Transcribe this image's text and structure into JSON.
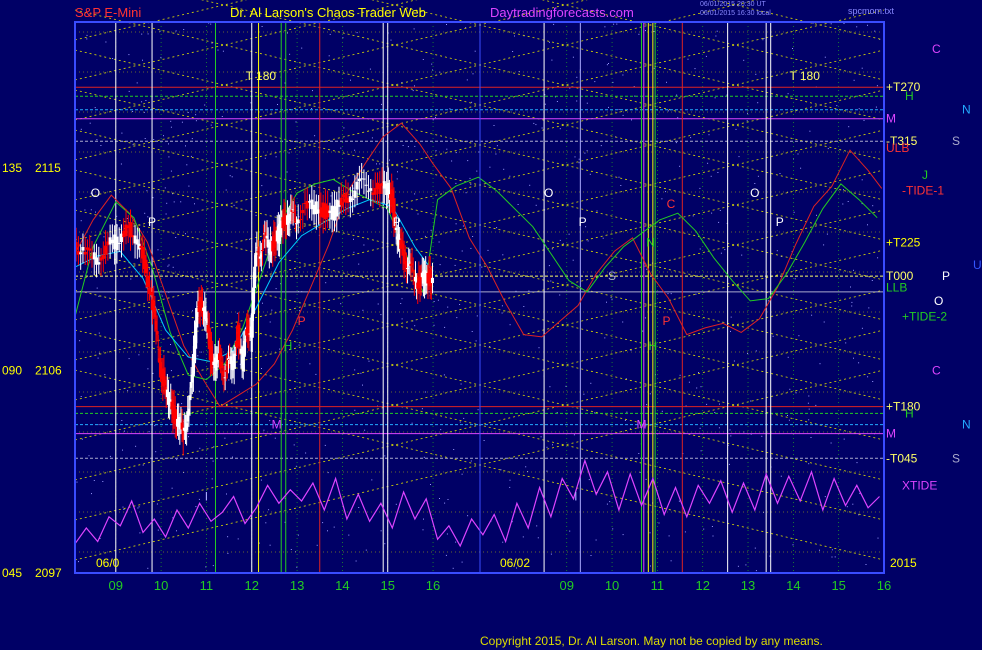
{
  "header": {
    "symbol": "S&P E-Mini",
    "site": "Dr. Al Larson's Chaos Trader Web",
    "url": "Daytradingforecasts.com",
    "stamp1": "06/01/2015 20:30 UT",
    "stamp2": "06/01/2015 16:30 local",
    "file": "spcmom.txt"
  },
  "copyright": "Copyright 2015, Dr. Al Larson. May not be copied by any means.",
  "colors": {
    "background": "#000066",
    "frame": "#3a4cff",
    "candle_up": "#ffffff",
    "candle_down": "#ff0000",
    "xtide": "#dd44ff",
    "moving_avg": "#00ccff",
    "green_band": "#22cc22",
    "red_band": "#dd2222",
    "grid_dots": "#e0e000"
  },
  "chart_data": {
    "type": "candlestick",
    "title": "S&P E-Mini",
    "y_axis_left": [
      {
        "angle": "135",
        "price": "2115"
      },
      {
        "angle": "090",
        "price": "2106"
      },
      {
        "angle": "045",
        "price": "2097"
      }
    ],
    "ylim": [
      2097,
      2121.5
    ],
    "x_ticks_day1": [
      "09",
      "10",
      "11",
      "12",
      "13",
      "14",
      "15",
      "16"
    ],
    "x_ticks_day2": [
      "09",
      "10",
      "11",
      "12",
      "13",
      "14",
      "15",
      "16"
    ],
    "date_labels": [
      "06/0",
      "06/02"
    ],
    "year_label": "2015",
    "right_labels": [
      {
        "text": "C",
        "color": "#dd44ff",
        "price": 2120.3
      },
      {
        "text": "+T270",
        "color": "#ffff66",
        "price": 2118.6
      },
      {
        "text": "H",
        "color": "#22cc22",
        "price": 2118.2
      },
      {
        "text": "N",
        "color": "#22aaff",
        "price": 2117.6
      },
      {
        "text": "M",
        "color": "#dd44ff",
        "price": 2117.2
      },
      {
        "text": "-T315",
        "color": "#ffff66",
        "price": 2116.2
      },
      {
        "text": "S",
        "color": "#aaaacc",
        "price": 2116.2
      },
      {
        "text": "ULB",
        "color": "#ff3333",
        "price": 2115.9
      },
      {
        "text": "J",
        "color": "#22cc22",
        "price": 2114.7
      },
      {
        "text": "-TIDE-1",
        "color": "#ff3333",
        "price": 2114.0
      },
      {
        "text": "+T225",
        "color": "#ffff00",
        "price": 2111.7
      },
      {
        "text": "U",
        "color": "#3355ff",
        "price": 2110.7
      },
      {
        "text": "T000",
        "color": "#ffff66",
        "price": 2110.2
      },
      {
        "text": "P",
        "color": "#ffffff",
        "price": 2110.2
      },
      {
        "text": "LLB",
        "color": "#22cc22",
        "price": 2109.7
      },
      {
        "text": "O",
        "color": "#ffffff",
        "price": 2109.1
      },
      {
        "text": "+TIDE-2",
        "color": "#22cc22",
        "price": 2108.4
      },
      {
        "text": "C",
        "color": "#dd44ff",
        "price": 2106.0
      },
      {
        "text": "+T180",
        "color": "#ffff66",
        "price": 2104.4
      },
      {
        "text": "H",
        "color": "#22cc22",
        "price": 2104.1
      },
      {
        "text": "N",
        "color": "#22aaff",
        "price": 2103.6
      },
      {
        "text": "M",
        "color": "#dd44ff",
        "price": 2103.2
      },
      {
        "text": "-T045",
        "color": "#ffff66",
        "price": 2102.1
      },
      {
        "text": "S",
        "color": "#aaaacc",
        "price": 2102.1
      },
      {
        "text": "XTIDE",
        "color": "#dd44ff",
        "price": 2100.9
      }
    ],
    "in_chart_labels": [
      {
        "text": "T 180",
        "color": "#ffff66",
        "price": 2119.1,
        "time": 12.2
      },
      {
        "text": "T 180",
        "color": "#ffff66",
        "price": 2119.1,
        "time": 24.2
      },
      {
        "text": "O",
        "color": "#ffffff",
        "price": 2113.9,
        "time": 8.55
      },
      {
        "text": "O",
        "color": "#ffffff",
        "price": 2113.9,
        "time": 18.55
      },
      {
        "text": "O",
        "color": "#ffffff",
        "price": 2113.9,
        "time": 23.1
      },
      {
        "text": "P",
        "color": "#ffffff",
        "price": 2112.6,
        "time": 9.8
      },
      {
        "text": "P",
        "color": "#ffffff",
        "price": 2112.6,
        "time": 15.2
      },
      {
        "text": "P",
        "color": "#ffffff",
        "price": 2112.6,
        "time": 19.3
      },
      {
        "text": "P",
        "color": "#ffffff",
        "price": 2112.6,
        "time": 23.65
      },
      {
        "text": "C",
        "color": "#ff3333",
        "price": 2113.4,
        "time": 21.25
      },
      {
        "text": "N",
        "color": "#22cc22",
        "price": 2111.7,
        "time": 20.8
      },
      {
        "text": "S",
        "color": "#aaaacc",
        "price": 2110.2,
        "time": 19.95
      },
      {
        "text": "P",
        "color": "#ff3333",
        "price": 2108.2,
        "time": 13.1
      },
      {
        "text": "P",
        "color": "#ff3333",
        "price": 2108.2,
        "time": 21.15
      },
      {
        "text": "H",
        "color": "#22cc22",
        "price": 2107.1,
        "time": 12.8
      },
      {
        "text": "H",
        "color": "#22cc22",
        "price": 2107.1,
        "time": 20.85
      },
      {
        "text": "M",
        "color": "#dd44ff",
        "price": 2103.6,
        "time": 12.55
      },
      {
        "text": "M",
        "color": "#dd44ff",
        "price": 2103.6,
        "time": 20.6
      },
      {
        "text": "I",
        "color": "#aaaaff",
        "price": 2100.4,
        "time": 11.0
      },
      {
        "text": "I",
        "color": "#aaaaff",
        "price": 2100.4,
        "time": 19.15
      }
    ],
    "xlim": [
      8.1,
      25.95
    ],
    "session_break": 16.0,
    "day2_offset": 9.95,
    "price_series": {
      "time": [
        8.1,
        8.3,
        8.5,
        8.7,
        8.9,
        9.1,
        9.3,
        9.5,
        9.65,
        9.8,
        9.9,
        10.0,
        10.1,
        10.2,
        10.3,
        10.4,
        10.5,
        10.6,
        10.7,
        10.8,
        10.9,
        11.0,
        11.1,
        11.2,
        11.3,
        11.4,
        11.5,
        11.6,
        11.7,
        11.8,
        11.9,
        12.0,
        12.1,
        12.2,
        12.3,
        12.4,
        12.5,
        12.6,
        12.7,
        12.8,
        12.9,
        13.0,
        13.2,
        13.4,
        13.6,
        13.8,
        14.0,
        14.2,
        14.4,
        14.6,
        14.8,
        15.0,
        15.1,
        15.2,
        15.3,
        15.4,
        15.5,
        15.6,
        15.7,
        15.8,
        15.9,
        16.0
      ],
      "price": [
        2111.7,
        2111.3,
        2110.9,
        2111.2,
        2111.6,
        2111.8,
        2112.5,
        2111.5,
        2110.8,
        2109.3,
        2107.6,
        2106.2,
        2105.1,
        2104.6,
        2104.1,
        2103.6,
        2103.1,
        2104.3,
        2105.5,
        2109.1,
        2108.8,
        2108.4,
        2106.8,
        2106.3,
        2106.5,
        2106.0,
        2106.2,
        2106.4,
        2107.7,
        2106.3,
        2107.9,
        2107.8,
        2111.1,
        2111.4,
        2111.8,
        2111.5,
        2111.7,
        2112.1,
        2112.6,
        2112.9,
        2112.8,
        2112.9,
        2113.2,
        2113.3,
        2113.1,
        2113.0,
        2113.5,
        2113.9,
        2114.2,
        2114.3,
        2114.0,
        2114.1,
        2113.7,
        2112.1,
        2111.4,
        2111.0,
        2110.5,
        2110.2,
        2109.9,
        2110.1,
        2110.2,
        2110.0
      ]
    },
    "xtide_series": {
      "time": [
        8.1,
        8.35,
        8.6,
        8.85,
        9.1,
        9.35,
        9.6,
        9.85,
        10.1,
        10.35,
        10.6,
        10.85,
        11.1,
        11.35,
        11.6,
        11.85,
        12.1,
        12.35,
        12.6,
        12.85,
        13.1,
        13.35,
        13.6,
        13.85,
        14.1,
        14.35,
        14.6,
        14.85,
        15.1,
        15.35,
        15.6,
        15.85,
        16.1,
        16.35,
        16.6,
        16.85,
        17.1,
        17.35,
        17.6,
        17.85,
        18.1,
        18.35,
        18.6,
        18.85,
        19.1,
        19.35,
        19.6,
        19.85,
        20.1,
        20.35,
        20.6,
        20.85,
        21.1,
        21.35,
        21.6,
        21.85,
        22.1,
        22.35,
        22.6,
        22.85,
        23.1,
        23.35,
        23.6,
        23.85,
        24.1,
        24.35,
        24.6,
        24.85,
        25.1,
        25.35,
        25.6,
        25.85
      ],
      "price": [
        2098.3,
        2099.0,
        2098.4,
        2099.5,
        2099.1,
        2100.2,
        2098.8,
        2099.4,
        2098.6,
        2099.8,
        2099.0,
        2100.1,
        2099.3,
        2099.7,
        2100.4,
        2099.2,
        2099.9,
        2100.9,
        2100.1,
        2100.7,
        2100.2,
        2101.0,
        2099.8,
        2101.2,
        2099.4,
        2100.5,
        2099.3,
        2100.1,
        2099.0,
        2100.6,
        2099.4,
        2100.3,
        2098.5,
        2099.1,
        2098.2,
        2099.4,
        2098.7,
        2099.6,
        2098.4,
        2100.1,
        2099.0,
        2100.8,
        2099.5,
        2101.2,
        2100.3,
        2102.0,
        2100.5,
        2101.5,
        2099.8,
        2101.4,
        2100.0,
        2101.2,
        2099.6,
        2100.8,
        2099.5,
        2100.9,
        2100.1,
        2101.1,
        2099.7,
        2101.0,
        2099.8,
        2101.4,
        2100.1,
        2101.3,
        2100.2,
        2101.5,
        2099.8,
        2101.2,
        2100.0,
        2100.9,
        2099.9,
        2100.4
      ]
    },
    "green_series": {
      "time": [
        8.1,
        8.5,
        9.0,
        9.4,
        9.8,
        10.2,
        10.6,
        11.0,
        11.4,
        11.8,
        12.2,
        12.6,
        13.0,
        13.4,
        13.8,
        14.2,
        14.6,
        15.0,
        15.4,
        15.8,
        16.1,
        16.5,
        17.0,
        17.4,
        17.8,
        18.2,
        18.6,
        19.0,
        19.4,
        19.8,
        20.2,
        20.6,
        21.0,
        21.4,
        21.8,
        22.2,
        22.6,
        23.0,
        23.4,
        23.8,
        24.2,
        24.6,
        25.0,
        25.4,
        25.8
      ],
      "price": [
        2108.4,
        2111.5,
        2113.5,
        2112.8,
        2110.6,
        2107.7,
        2105.8,
        2105.6,
        2106.3,
        2107.9,
        2110.2,
        2112.5,
        2113.9,
        2114.3,
        2114.5,
        2114.0,
        2113.6,
        2113.2,
        2111.2,
        2109.4,
        2113.6,
        2114.2,
        2114.6,
        2114.0,
        2113.2,
        2112.4,
        2111.2,
        2110.0,
        2109.5,
        2110.6,
        2111.5,
        2112.1,
        2112.7,
        2113.0,
        2112.2,
        2111.0,
        2110.0,
        2109.1,
        2109.2,
        2110.3,
        2111.7,
        2113.2,
        2114.3,
        2113.6,
        2112.8
      ]
    },
    "moving_avg_series": {
      "time": [
        8.1,
        8.6,
        9.1,
        9.6,
        10.1,
        10.6,
        11.1,
        11.6,
        12.1,
        12.6,
        13.1,
        13.6,
        14.1,
        14.6,
        15.1,
        15.6,
        16.0
      ],
      "price": [
        2110.6,
        2111.1,
        2111.3,
        2110.1,
        2107.8,
        2106.6,
        2106.4,
        2106.9,
        2108.8,
        2110.8,
        2112.0,
        2112.6,
        2113.2,
        2113.6,
        2113.3,
        2111.5,
        2110.4
      ]
    },
    "red_series": {
      "time": [
        8.1,
        8.5,
        8.9,
        9.3,
        9.7,
        10.1,
        10.5,
        10.9,
        11.3,
        11.7,
        12.1,
        12.5,
        12.9,
        13.3,
        13.7,
        14.1,
        14.5,
        14.9,
        15.3,
        15.7,
        16.0,
        16.4,
        16.8,
        17.2,
        17.6,
        18.0,
        18.4,
        18.8,
        19.2,
        19.6,
        20.0,
        20.4,
        20.8,
        21.2,
        21.6,
        22.0,
        22.4,
        22.8,
        23.2,
        23.6,
        24.0,
        24.4,
        24.8,
        25.2,
        25.6,
        25.9
      ],
      "price": [
        2111.2,
        2112.7,
        2113.8,
        2113.0,
        2111.7,
        2109.4,
        2107.1,
        2105.7,
        2104.4,
        2104.9,
        2105.4,
        2106.3,
        2107.8,
        2109.7,
        2111.6,
        2113.9,
        2115.2,
        2116.4,
        2117.0,
        2116.1,
        2115.2,
        2114.1,
        2111.9,
        2110.6,
        2109.0,
        2107.6,
        2107.5,
        2108.2,
        2108.9,
        2110.3,
        2111.3,
        2111.9,
        2110.3,
        2109.2,
        2107.6,
        2107.9,
        2108.1,
        2107.7,
        2108.3,
        2109.7,
        2111.6,
        2113.3,
        2114.2,
        2115.8,
        2114.9,
        2114.1
      ]
    },
    "horizontal_levels": [
      {
        "price": 2118.6,
        "color": "#dd2222",
        "style": "solid"
      },
      {
        "price": 2118.2,
        "color": "#22cc22",
        "style": "dash"
      },
      {
        "price": 2117.6,
        "color": "#22aaff",
        "style": "dash"
      },
      {
        "price": 2117.2,
        "color": "#dd44ff",
        "style": "solid"
      },
      {
        "price": 2116.2,
        "color": "#aaaacc",
        "style": "dash"
      },
      {
        "price": 2110.2,
        "color": "#ffff66",
        "style": "dash"
      },
      {
        "price": 2109.5,
        "color": "#aaaacc",
        "style": "solid"
      },
      {
        "price": 2104.4,
        "color": "#dd2222",
        "style": "solid"
      },
      {
        "price": 2104.1,
        "color": "#22cc22",
        "style": "dash"
      },
      {
        "price": 2103.6,
        "color": "#22aaff",
        "style": "dash"
      },
      {
        "price": 2103.2,
        "color": "#dd44ff",
        "style": "solid"
      },
      {
        "price": 2102.1,
        "color": "#aaaacc",
        "style": "dash"
      }
    ],
    "vertical_lines": [
      {
        "time": 9.0,
        "color": "#ffffff"
      },
      {
        "time": 9.8,
        "color": "#ffffff"
      },
      {
        "time": 11.2,
        "color": "#22cc22"
      },
      {
        "time": 12.0,
        "color": "#ffffff"
      },
      {
        "time": 12.15,
        "color": "#ffff00"
      },
      {
        "time": 12.65,
        "color": "#22cc22"
      },
      {
        "time": 12.75,
        "color": "#22cc22"
      },
      {
        "time": 13.5,
        "color": "#dd2222"
      },
      {
        "time": 14.9,
        "color": "#ffffff"
      },
      {
        "time": 15.0,
        "color": "#ffffff"
      },
      {
        "time": 18.45,
        "color": "#ffffff"
      },
      {
        "time": 19.25,
        "color": "#aaaaff"
      },
      {
        "time": 20.6,
        "color": "#22cc22"
      },
      {
        "time": 20.65,
        "color": "#dd44ff"
      },
      {
        "time": 20.75,
        "color": "#ffff00"
      },
      {
        "time": 20.85,
        "color": "#ffff00"
      },
      {
        "time": 20.9,
        "color": "#22cc22"
      },
      {
        "time": 21.5,
        "color": "#dd2222"
      },
      {
        "time": 22.5,
        "color": "#ffffff"
      },
      {
        "time": 23.35,
        "color": "#ffffff"
      },
      {
        "time": 23.45,
        "color": "#ffffff"
      }
    ]
  }
}
